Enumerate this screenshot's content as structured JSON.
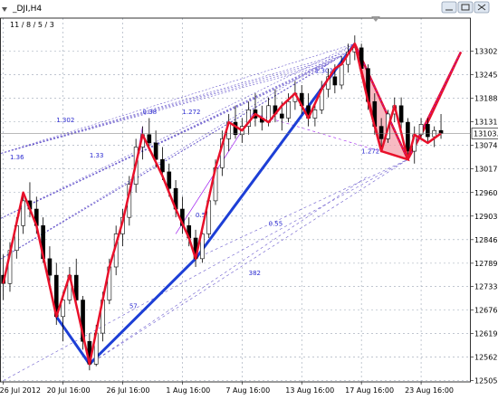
{
  "window": {
    "title": "_DJI,H4",
    "legend": "11 / 8 / 5 / 3",
    "controls": [
      "minimize",
      "restore",
      "close"
    ]
  },
  "colors": {
    "bull": "#000000",
    "bear": "#000000",
    "zigzag": "#e8102a",
    "trend": "#1d3fd6",
    "fib": "#6a5acd",
    "fib_purple": "#a020f0",
    "pattern_fill": "#f4a3ad",
    "grid": "#9aa5b4"
  },
  "chart_data": {
    "type": "candlestick",
    "ylim": [
      12502,
      13360
    ],
    "yticks": [
      13302,
      13245,
      13188,
      13131,
      13074,
      13017,
      12960,
      12903,
      12846,
      12789,
      12733,
      12676,
      12619,
      12562,
      12505
    ],
    "xtick_labels": [
      "26 Jul 2012",
      "20 Jul 16:00",
      "26 Jul 16:00",
      "1 Aug 16:00",
      "7 Aug 16:00",
      "13 Aug 16:00",
      "17 Aug 16:00",
      "23 Aug 16:00"
    ],
    "current_price": "13103.1",
    "current_price_value": 13103,
    "candles": [
      [
        12760,
        12810,
        12700,
        12740
      ],
      [
        12740,
        12840,
        12720,
        12820
      ],
      [
        12820,
        12900,
        12800,
        12880
      ],
      [
        12880,
        12960,
        12860,
        12940
      ],
      [
        12940,
        12985,
        12900,
        12920
      ],
      [
        12920,
        12950,
        12860,
        12880
      ],
      [
        12880,
        12900,
        12790,
        12800
      ],
      [
        12800,
        12830,
        12740,
        12760
      ],
      [
        12760,
        12790,
        12640,
        12660
      ],
      [
        12660,
        12720,
        12600,
        12700
      ],
      [
        12700,
        12780,
        12690,
        12760
      ],
      [
        12760,
        12800,
        12680,
        12700
      ],
      [
        12700,
        12710,
        12580,
        12600
      ],
      [
        12600,
        12620,
        12530,
        12545
      ],
      [
        12545,
        12640,
        12540,
        12620
      ],
      [
        12620,
        12720,
        12600,
        12700
      ],
      [
        12700,
        12800,
        12690,
        12780
      ],
      [
        12780,
        12880,
        12760,
        12860
      ],
      [
        12860,
        12920,
        12830,
        12900
      ],
      [
        12900,
        13000,
        12880,
        12980
      ],
      [
        12980,
        13090,
        12960,
        13070
      ],
      [
        13070,
        13120,
        13040,
        13100
      ],
      [
        13100,
        13140,
        13060,
        13080
      ],
      [
        13080,
        13110,
        13020,
        13040
      ],
      [
        13040,
        13070,
        12990,
        13010
      ],
      [
        13010,
        13030,
        12950,
        12970
      ],
      [
        12970,
        12990,
        12900,
        12920
      ],
      [
        12920,
        12950,
        12860,
        12880
      ],
      [
        12880,
        12900,
        12830,
        12850
      ],
      [
        12850,
        12870,
        12780,
        12800
      ],
      [
        12800,
        12880,
        12790,
        12860
      ],
      [
        12860,
        12950,
        12850,
        12940
      ],
      [
        12940,
        13040,
        12930,
        13020
      ],
      [
        13020,
        13110,
        13000,
        13090
      ],
      [
        13090,
        13150,
        13060,
        13130
      ],
      [
        13130,
        13170,
        13090,
        13100
      ],
      [
        13100,
        13140,
        13080,
        13120
      ],
      [
        13120,
        13180,
        13100,
        13160
      ],
      [
        13160,
        13200,
        13120,
        13140
      ],
      [
        13140,
        13170,
        13110,
        13130
      ],
      [
        13130,
        13190,
        13120,
        13170
      ],
      [
        13170,
        13210,
        13130,
        13150
      ],
      [
        13150,
        13180,
        13110,
        13140
      ],
      [
        13140,
        13200,
        13130,
        13180
      ],
      [
        13180,
        13230,
        13160,
        13200
      ],
      [
        13200,
        13220,
        13150,
        13170
      ],
      [
        13170,
        13200,
        13120,
        13140
      ],
      [
        13140,
        13180,
        13120,
        13160
      ],
      [
        13160,
        13230,
        13150,
        13210
      ],
      [
        13210,
        13260,
        13190,
        13240
      ],
      [
        13240,
        13270,
        13200,
        13220
      ],
      [
        13220,
        13290,
        13210,
        13270
      ],
      [
        13270,
        13320,
        13250,
        13300
      ],
      [
        13300,
        13340,
        13280,
        13310
      ],
      [
        13310,
        13320,
        13240,
        13260
      ],
      [
        13260,
        13270,
        13160,
        13180
      ],
      [
        13180,
        13200,
        13100,
        13120
      ],
      [
        13120,
        13140,
        13060,
        13090
      ],
      [
        13090,
        13160,
        13080,
        13150
      ],
      [
        13150,
        13190,
        13130,
        13170
      ],
      [
        13170,
        13190,
        13110,
        13130
      ],
      [
        13130,
        13140,
        13040,
        13060
      ],
      [
        13060,
        13120,
        13030,
        13100
      ],
      [
        13100,
        13140,
        13090,
        13125
      ],
      [
        13125,
        13140,
        13080,
        13095
      ],
      [
        13095,
        13120,
        13070,
        13110
      ],
      [
        13110,
        13150,
        13090,
        13103
      ]
    ],
    "zigzag": [
      [
        0,
        12740
      ],
      [
        3,
        12960
      ],
      [
        5,
        12880
      ],
      [
        8,
        12660
      ],
      [
        10,
        12760
      ],
      [
        13,
        12545
      ],
      [
        16,
        12780
      ],
      [
        18,
        12890
      ],
      [
        19,
        12960
      ],
      [
        21,
        13100
      ],
      [
        24,
        13000
      ],
      [
        26,
        12920
      ],
      [
        28,
        12850
      ],
      [
        29,
        12800
      ],
      [
        32,
        13020
      ],
      [
        34,
        13130
      ],
      [
        36,
        13110
      ],
      [
        38,
        13150
      ],
      [
        40,
        13130
      ],
      [
        42,
        13170
      ],
      [
        44,
        13200
      ],
      [
        46,
        13140
      ],
      [
        48,
        13210
      ],
      [
        50,
        13260
      ],
      [
        51,
        13270
      ],
      [
        53,
        13320
      ],
      [
        55,
        13180
      ],
      [
        57,
        13060
      ],
      [
        59,
        13170
      ],
      [
        61,
        13040
      ],
      [
        62,
        13100
      ],
      [
        64,
        13080
      ],
      [
        66,
        13103
      ]
    ],
    "trend_lines": [
      [
        [
          13,
          12545
        ],
        [
          29,
          12800
        ]
      ],
      [
        [
          29,
          12800
        ],
        [
          53,
          13320
        ]
      ],
      [
        [
          8,
          12660
        ],
        [
          13,
          12545
        ]
      ]
    ],
    "harmonic_pattern": [
      [
        53,
        13320
      ],
      [
        57,
        13060
      ],
      [
        61,
        13040
      ],
      [
        64,
        13130
      ],
      [
        69,
        13300
      ]
    ],
    "fib_labels": [
      "1.302",
      "1.272",
      "1.302",
      "1.272",
      "1.36",
      "1.33",
      "0.5",
      "0.55",
      "382",
      "57",
      "0.38"
    ]
  }
}
